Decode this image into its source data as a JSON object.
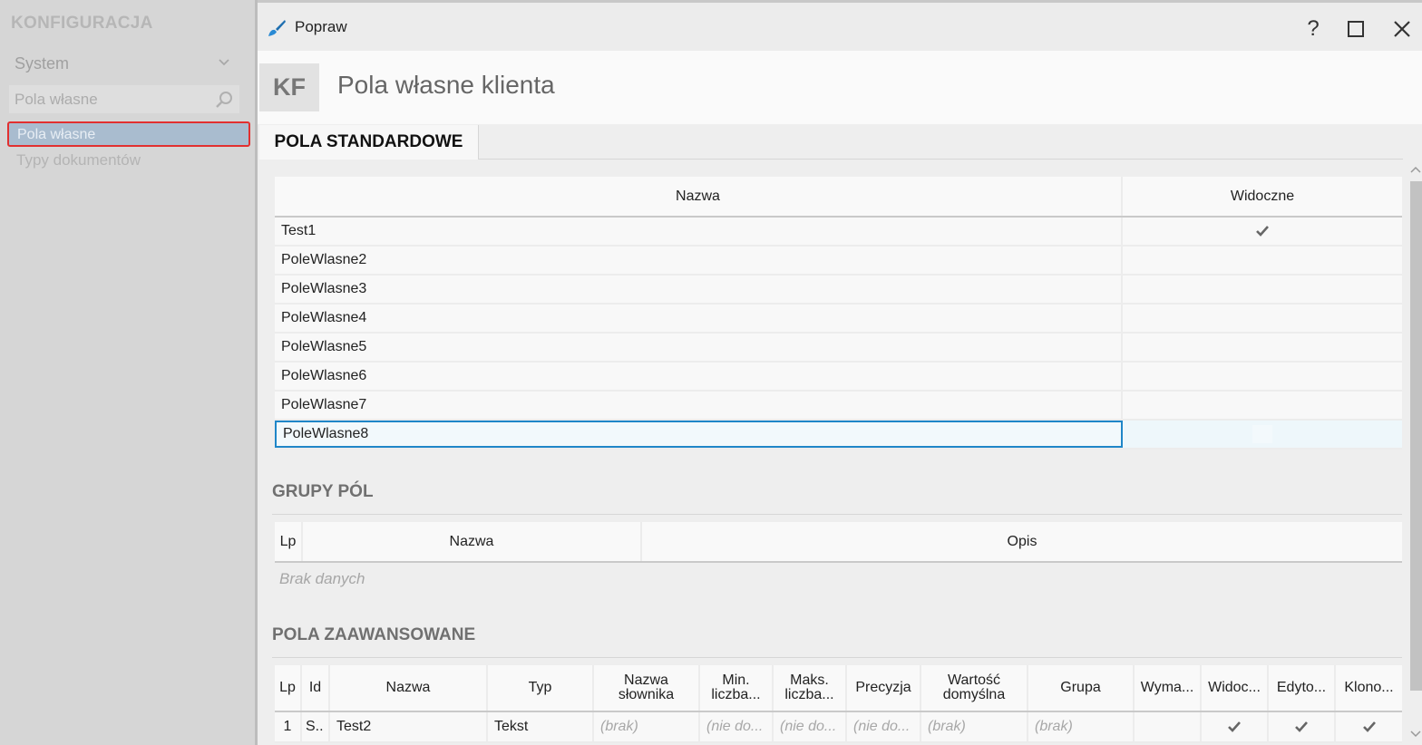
{
  "sidebar": {
    "title": "KONFIGURACJA",
    "system_label": "System",
    "search_placeholder": "Pola własne",
    "items": [
      {
        "label": "Pola własne"
      },
      {
        "label": "Typy dokumentów"
      }
    ]
  },
  "dialog": {
    "window_title": "Popraw",
    "help_label": "?",
    "badge": "KF",
    "title": "Pola własne klienta",
    "tab_label": "POLA STANDARDOWE"
  },
  "standard_fields": {
    "columns": [
      "Nazwa",
      "Widoczne"
    ],
    "rows": [
      {
        "name": "Test1",
        "visible": true
      },
      {
        "name": "PoleWlasne2",
        "visible": false
      },
      {
        "name": "PoleWlasne3",
        "visible": false
      },
      {
        "name": "PoleWlasne4",
        "visible": false
      },
      {
        "name": "PoleWlasne5",
        "visible": false
      },
      {
        "name": "PoleWlasne6",
        "visible": false
      },
      {
        "name": "PoleWlasne7",
        "visible": false
      },
      {
        "name": "PoleWlasne8",
        "visible": false
      }
    ]
  },
  "field_groups": {
    "title": "GRUPY PÓL",
    "columns": [
      "Lp",
      "Nazwa",
      "Opis"
    ],
    "empty_text": "Brak danych"
  },
  "advanced_fields": {
    "title": "POLA ZAAWANSOWANE",
    "columns": [
      "Lp",
      "Id",
      "Nazwa",
      "Typ",
      "Nazwa\nsłownika",
      "Min.\nliczba...",
      "Maks.\nliczba...",
      "Precyzja",
      "Wartość\ndomyślna",
      "Grupa",
      "Wyma...",
      "Widoc...",
      "Edyto...",
      "Klono..."
    ],
    "rows": [
      {
        "lp": "1",
        "id": "S..",
        "name": "Test2",
        "type": "Tekst",
        "dict": "(brak)",
        "min": "(nie do...",
        "max": "(nie do...",
        "precision": "(nie do...",
        "default": "(brak)",
        "group": "(brak)",
        "required": false,
        "visible": true,
        "editable": true,
        "clonable": true
      }
    ]
  },
  "colors": {
    "accent": "#1f86c8",
    "selection_outline": "#e23030"
  }
}
